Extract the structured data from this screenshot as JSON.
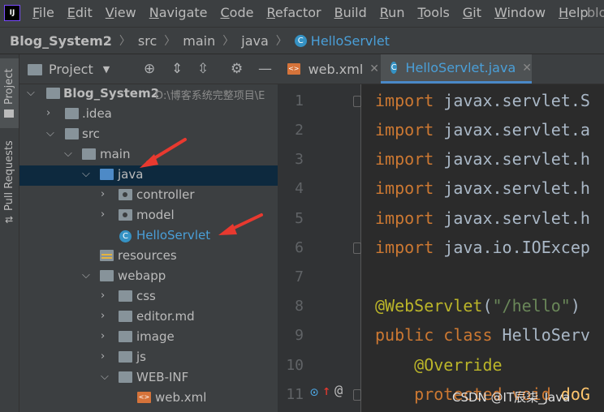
{
  "menubar": {
    "logo": "IJ",
    "items": [
      "File",
      "Edit",
      "View",
      "Navigate",
      "Code",
      "Refactor",
      "Build",
      "Run",
      "Tools",
      "Git",
      "Window",
      "Help"
    ],
    "mnemonics": [
      "F",
      "E",
      "V",
      "N",
      "C",
      "R",
      "B",
      "R",
      "T",
      "G",
      "W",
      "H"
    ],
    "title_cut": "blo"
  },
  "breadcrumb": [
    "Blog_System2",
    "src",
    "main",
    "java",
    "HelloServlet"
  ],
  "toolstrip": {
    "project": "Project",
    "pull_requests": "Pull Requests"
  },
  "panel": {
    "title": "Project"
  },
  "tree": [
    {
      "label": "Blog_System2",
      "hint": "D:\\博客系统完整项目\\E"
    },
    {
      "label": ".idea"
    },
    {
      "label": "src"
    },
    {
      "label": "main"
    },
    {
      "label": "java"
    },
    {
      "label": "controller"
    },
    {
      "label": "model"
    },
    {
      "label": "HelloServlet"
    },
    {
      "label": "resources"
    },
    {
      "label": "webapp"
    },
    {
      "label": "css"
    },
    {
      "label": "editor.md"
    },
    {
      "label": "image"
    },
    {
      "label": "js"
    },
    {
      "label": "WEB-INF"
    },
    {
      "label": "web.xml"
    }
  ],
  "editor_tabs": [
    {
      "label": "web.xml",
      "active": false
    },
    {
      "label": "HelloServlet.java",
      "active": true
    }
  ],
  "line_numbers": [
    "1",
    "2",
    "3",
    "4",
    "5",
    "6",
    "7",
    "8",
    "9",
    "10",
    "11"
  ],
  "code_lines": [
    {
      "kw": "import",
      "rest": " javax.servlet.S"
    },
    {
      "kw": "import",
      "rest": " javax.servlet.a"
    },
    {
      "kw": "import",
      "rest": " javax.servlet.h"
    },
    {
      "kw": "import",
      "rest": " javax.servlet.h"
    },
    {
      "kw": "import",
      "rest": " javax.servlet.h"
    },
    {
      "kw": "import",
      "rest": " java.io.IOExcep"
    },
    {
      "kw": "",
      "rest": ""
    },
    {
      "an": "@WebServlet",
      "paren_open": "(",
      "str": "\"/hello\"",
      "paren_close": ")"
    },
    {
      "kw": "public class",
      "rest": " HelloServ"
    },
    {
      "an": "    @Override"
    },
    {
      "kw": "    protected void",
      "rest": " doG"
    }
  ],
  "watermark": "CSDN @IT辰柒_Java",
  "colors": {
    "accent": "#4a88c7",
    "selection": "#0d293e",
    "keyword": "#cc7832",
    "annotation": "#bbb529",
    "string": "#6a8759",
    "arrows": "#e8392f"
  }
}
